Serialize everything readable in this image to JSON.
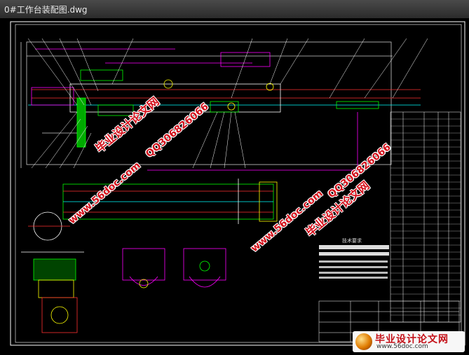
{
  "window": {
    "title": "0#工作台装配图.dwg"
  },
  "watermarks": {
    "brand": "毕业设计论文网",
    "qq": "QQ306826066",
    "url": "www.56doc.com"
  },
  "logo": {
    "brand": "毕业设计论文网",
    "url": "www.56doc.com"
  },
  "notes": {
    "heading": "技术要求"
  },
  "colors": {
    "background": "#000000",
    "frame": "#ffffff",
    "green": "#00ff00",
    "magenta": "#ff00ff",
    "red": "#ff3030",
    "cyan": "#00ffff",
    "yellow": "#ffff00",
    "watermark": "#d3101b"
  }
}
